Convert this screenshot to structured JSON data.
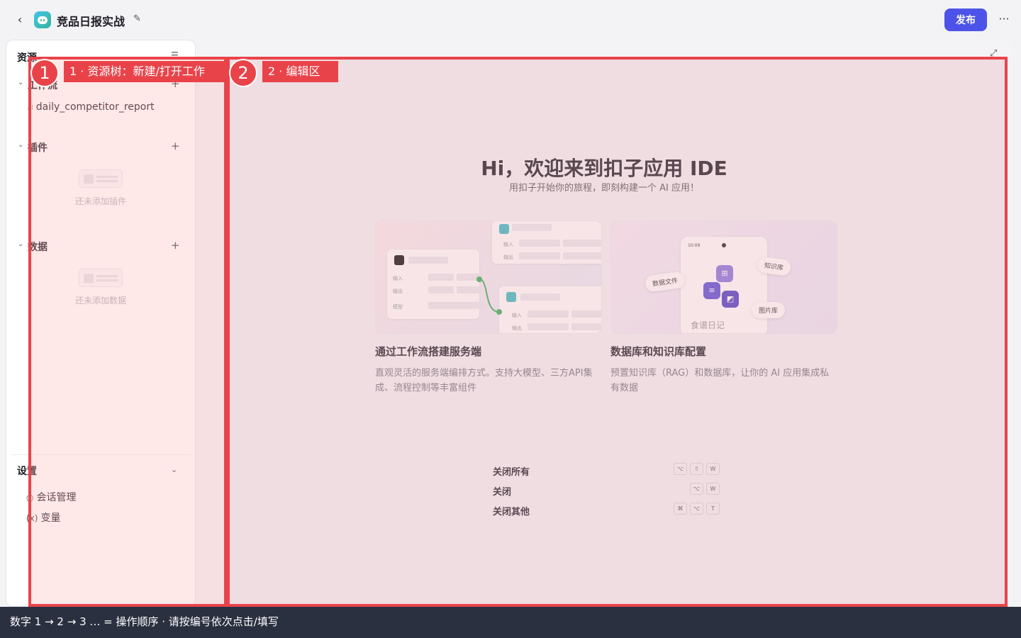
{
  "header": {
    "title": "竞品日报实战",
    "publish_label": "发布",
    "more_label": "···"
  },
  "sidebar": {
    "title": "资源",
    "sections": {
      "workflow": {
        "label": "工作流",
        "items": [
          "daily_competitor_report"
        ]
      },
      "plugins": {
        "label": "插件",
        "empty_text": "还未添加插件"
      },
      "data": {
        "label": "数据",
        "empty_text": "还未添加数据"
      }
    },
    "settings": {
      "label": "设置",
      "items": [
        "会话管理",
        "变量"
      ]
    }
  },
  "main": {
    "welcome_title": "Hi，欢迎来到扣子应用 IDE",
    "welcome_subtitle": "用扣子开始你的旅程，即刻构建一个 AI 应用！",
    "cards": [
      {
        "title": "通过工作流搭建服务端",
        "desc": "直观灵活的服务端编排方式。支持大模型、三方API集成、流程控制等丰富组件",
        "illus": {
          "in": "输入",
          "out": "输出",
          "model": "模型"
        }
      },
      {
        "title": "数据库和知识库配置",
        "desc": "预置知识库（RAG）和数据库，让你的 AI 应用集成私有数据",
        "illus": {
          "time": "10:09",
          "kb": "知识库",
          "files": "数据文件",
          "images": "图片库",
          "recipe": "食谱日记"
        }
      }
    ],
    "shortcuts": [
      {
        "label": "关闭所有",
        "keys": [
          "⌥",
          "⇧",
          "W"
        ]
      },
      {
        "label": "关闭",
        "keys": [
          "⌥",
          "W"
        ]
      },
      {
        "label": "关闭其他",
        "keys": [
          "⌘",
          "⌥",
          "T"
        ]
      }
    ]
  },
  "annotations": [
    {
      "number": "1",
      "text": "1 ·  资源树：新建/打开工作"
    },
    {
      "number": "2",
      "text": "2 ·  编辑区"
    }
  ],
  "hint_bar": "数字 1 → 2 → 3 … = 操作顺序 ·  请按编号依次点击/填写",
  "colors": {
    "accent": "#4d53e8",
    "annotation": "#e9434a",
    "hint_bg": "#2b3040"
  }
}
